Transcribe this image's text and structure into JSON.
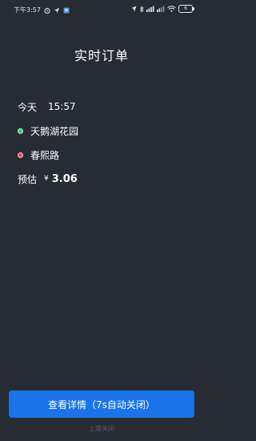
{
  "status_bar": {
    "time": "下午3:57",
    "battery": "6"
  },
  "page": {
    "title": "实时订单"
  },
  "order": {
    "day": "今天",
    "time": "15:57",
    "start": "天鹅湖花园",
    "destination": "春熙路",
    "estimate_label": "预估",
    "currency": "¥",
    "amount": "3.06"
  },
  "actions": {
    "detail_button": "查看详情（7s自动关闭）",
    "close_hint": "上滑关闭"
  },
  "colors": {
    "background": "#262b34",
    "button": "#1a73e8",
    "start_dot": "#2fd06a",
    "end_dot": "#f04b4b"
  }
}
